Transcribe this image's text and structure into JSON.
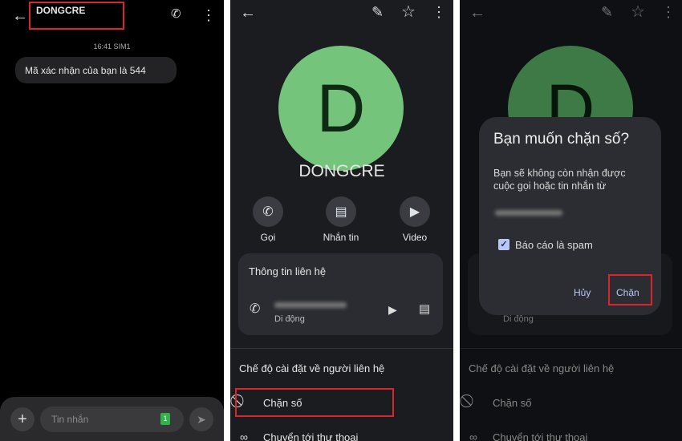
{
  "messages": {
    "contact_name": "DONGCRE",
    "timestamp": "16:41 SIM1",
    "bubble_text": "Mã xác nhận của bạn là 544",
    "input_placeholder": "Tin nhắn",
    "sim_badge": "1"
  },
  "contact": {
    "avatar_letter": "D",
    "name": "DONGCRE",
    "actions": [
      {
        "label": "Gọi",
        "icon": "phone-icon"
      },
      {
        "label": "Nhắn tin",
        "icon": "message-icon"
      },
      {
        "label": "Video",
        "icon": "video-icon"
      }
    ],
    "info_title": "Thông tin liên hệ",
    "phone_type": "Di động",
    "settings_title": "Chế độ cài đặt về người liên hệ",
    "settings_items": [
      "Chặn số",
      "Chuyển tới thư thoại"
    ]
  },
  "dialog": {
    "title": "Bạn muốn chặn số?",
    "body": "Bạn sẽ không còn nhận được cuộc gọi hoặc tin nhắn từ",
    "checkbox_label": "Báo cáo là spam",
    "checkbox_checked": true,
    "cancel_label": "Hủy",
    "confirm_label": "Chặn"
  },
  "colors": {
    "avatar": "#74c47c",
    "avatar_dimmed": "#3d7a45",
    "highlight": "#d9262c",
    "sim_badge": "#2fb34a"
  }
}
